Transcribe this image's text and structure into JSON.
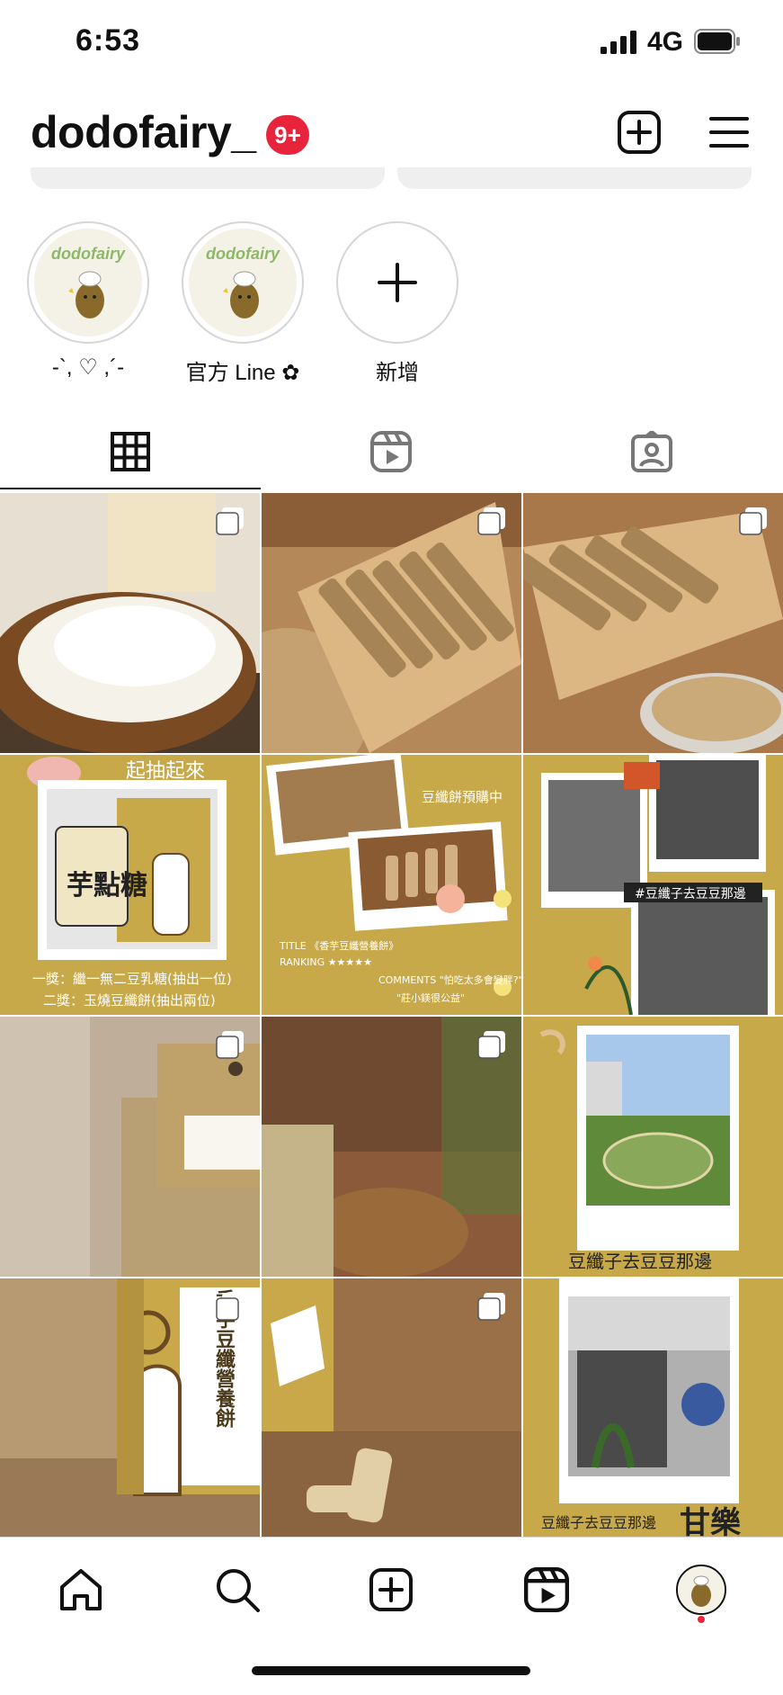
{
  "status_bar": {
    "time": "6:53",
    "network": "4G"
  },
  "header": {
    "username": "dodofairy_",
    "notification_badge": "9+"
  },
  "highlights": [
    {
      "label": "-`, ♡ ,´-",
      "brand": "dodofairy"
    },
    {
      "label": "官方 Line ✿",
      "brand": "dodofairy"
    },
    {
      "label": "新增"
    }
  ],
  "tabs": [
    "grid-icon",
    "reels-icon",
    "tagged-icon"
  ],
  "grid": {
    "posts": [
      {
        "id": 1,
        "kind": "photo-flour",
        "multi": true
      },
      {
        "id": 2,
        "kind": "photo-sticks-board",
        "multi": true
      },
      {
        "id": 3,
        "kind": "photo-sticks-quinoa",
        "multi": true
      },
      {
        "id": 4,
        "kind": "poster-giveaway",
        "multi": false,
        "text_top": "起抽起來",
        "pkg_text": "芋點糖",
        "line1": "一獎：繼一無二豆乳糖(抽出一位)",
        "line2": "二獎：玉燒豆纖餅(抽出兩位)"
      },
      {
        "id": 5,
        "kind": "poster-preorder",
        "multi": false,
        "title": "豆纖餅預購中",
        "caption1": "TITLE 《香芋豆纖營養餅》",
        "caption2": "RANKING ★★★★★",
        "caption3": "COMMENTS \"怕吃太多會變胖?\"",
        "caption4": "\"莊小鎂很公益\""
      },
      {
        "id": 6,
        "kind": "poster-bw-photos",
        "multi": false,
        "tag": "#豆纖子去豆豆那邊"
      },
      {
        "id": 7,
        "kind": "product-box-tl",
        "multi": true
      },
      {
        "id": 8,
        "kind": "product-box-tr",
        "multi": true
      },
      {
        "id": 9,
        "kind": "poster-campus",
        "multi": false,
        "caption": "豆纖子去豆豆那邊"
      },
      {
        "id": 10,
        "kind": "product-box-bl",
        "multi": true,
        "box_text": "香芋豆纖營養餅"
      },
      {
        "id": 11,
        "kind": "product-box-br",
        "multi": true
      },
      {
        "id": 12,
        "kind": "poster-building",
        "multi": false,
        "caption": "豆纖子去豆豆那邊",
        "tag": "甘樂"
      }
    ]
  },
  "bottom_nav": [
    "home-icon",
    "search-icon",
    "create-icon",
    "reels-icon",
    "profile-avatar"
  ],
  "colors": {
    "badge": "#e8243d",
    "mustard": "#c8a94a",
    "wood": "#c89a63"
  }
}
